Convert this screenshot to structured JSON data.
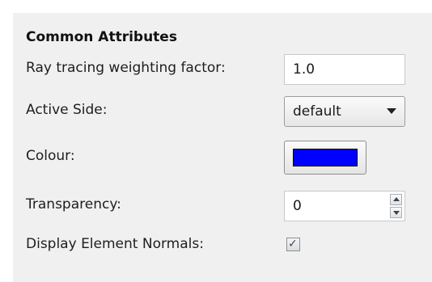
{
  "section": {
    "title": "Common Attributes"
  },
  "fields": {
    "ray_tracing": {
      "label": "Ray tracing weighting factor:",
      "value": "1.0"
    },
    "active_side": {
      "label": "Active Side:",
      "selected": "default"
    },
    "colour": {
      "label": "Colour:",
      "swatch_color": "#0000ff"
    },
    "transparency": {
      "label": "Transparency:",
      "value": "0"
    },
    "display_normals": {
      "label": "Display Element Normals:",
      "checked": true
    }
  },
  "icons": {
    "dropdown_arrow": "chevron-down-icon",
    "spin_up": "arrow-up-icon",
    "spin_down": "arrow-down-icon",
    "check": "checkmark-icon"
  }
}
